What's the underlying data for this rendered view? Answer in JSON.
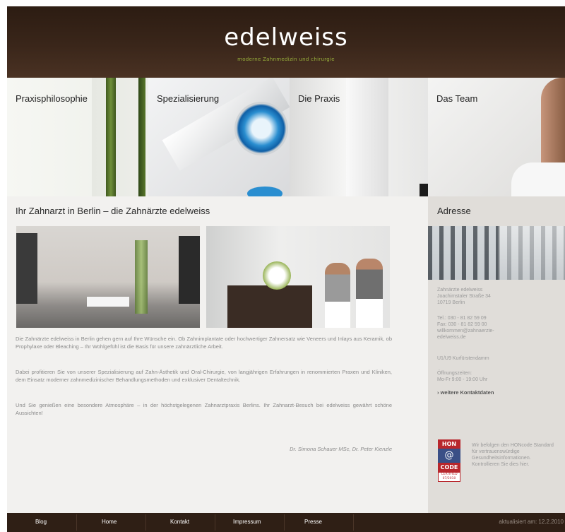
{
  "header": {
    "logo": "edelweiss",
    "tagline": "moderne Zahnmedizin und chirurgie"
  },
  "nav": [
    {
      "label": "Praxisphilosophie"
    },
    {
      "label": "Spezialisierung"
    },
    {
      "label": "Die Praxis"
    },
    {
      "label": "Das Team"
    }
  ],
  "main": {
    "title": "Ihr Zahnarzt in Berlin – die Zahnärzte edelweiss",
    "paragraphs": [
      "Die Zahnärzte edelweiss in Berlin gehen gern auf Ihre Wünsche ein. Ob Zahnimplantate oder hochwertiger Zahnersatz wie Veneers und Inlays aus Keramik, ob Prophylaxe oder Bleaching – Ihr Wohlgefühl ist die Basis für unsere zahnärztliche Arbeit.",
      "Dabei profitieren Sie von unserer Spezialisierung auf Zahn-Ästhetik und Oral-Chirurgie, von langjährigen Erfahrungen in renommierten Praxen und Kliniken, dem Einsatz moderner zahnmedizinischer Behandlungsmethoden und exklusiver Dentaltechnik.",
      "Und Sie genießen eine besondere Atmosphäre – in der höchstgelegenen Zahnarztpraxis Berlins. Ihr Zahnarzt-Besuch bei edelweiss gewährt schöne Aussichten!"
    ],
    "signature": "Dr. Simona Schauer MSc, Dr. Peter Kienzle"
  },
  "sidebar": {
    "title": "Adresse",
    "address": [
      "Zahnärzte edelweiss",
      "Joachimstaler Straße 34",
      "10719 Berlin"
    ],
    "contact": [
      "Tel.: 030 - 81 82 59 09",
      "Fax: 030 - 81 82 59 00",
      "willkommen@zahnaerzte-",
      "edelweiss.de"
    ],
    "transit": "U1/U9 Kurfürstendamm",
    "hours_label": "Öffnungszeiten:",
    "hours": "Mo-Fr 9:00 - 19:00 Uhr",
    "more_link": "› weitere Kontaktdaten",
    "hon": {
      "top": "HON",
      "mid": "@",
      "code": "CODE",
      "certified": "CERTIFIED 07/2010",
      "text": "Wir befolgen den HONcode Standard für vertrauenswürdige Gesundheitsinformationen. Kontrollieren Sie dies hier."
    }
  },
  "footer": {
    "links": [
      "Blog",
      "Home",
      "Kontakt",
      "Impressum",
      "Presse"
    ],
    "updated": "aktualisiert am: 12.2.2010"
  },
  "colors": {
    "header_brown": "#3a261a",
    "tagline_green": "#98b03c",
    "main_bg": "#f2f1ef",
    "side_bg": "#e0ddd9",
    "hon_red": "#b8262c",
    "hon_blue": "#3a4f86"
  }
}
